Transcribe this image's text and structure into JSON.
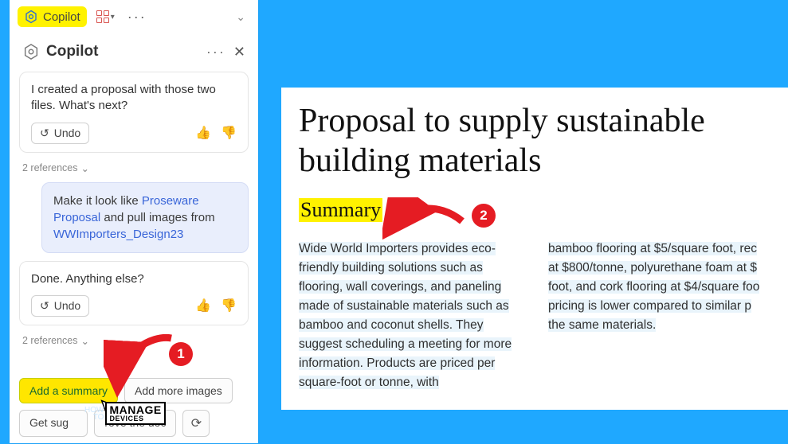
{
  "toolbar": {
    "copilot_label": "Copilot"
  },
  "panel": {
    "title": "Copilot",
    "block1_text": "I created a proposal with those two files. What's next?",
    "undo_label": "Undo",
    "refs_label": "2 references",
    "user_prefix": "Make it look like ",
    "user_link1": "Proseware Proposal",
    "user_mid": " and pull images from ",
    "user_link2": "WWImporters_Design23",
    "block2_text": "Done. Anything else?",
    "sugg_add_summary": "Add a summary",
    "sugg_add_images": "Add more images",
    "sugg_get": "Get sug",
    "sugg_improve": "rove the doc"
  },
  "doc": {
    "title": "Proposal to supply sustainable building materials",
    "summary_heading": "Summary",
    "col1": "Wide World Importers provides eco-friendly building solutions such as flooring, wall coverings, and paneling made of sustainable materials such as bamboo and coconut shells. They suggest scheduling a meeting for more information. Products are priced per square-foot or tonne, with",
    "col2": "bamboo flooring at $5/square foot, rec at $800/tonne, polyurethane foam at $ foot, and cork flooring at $4/square foo pricing is lower compared to similar p the same materials."
  },
  "annot": {
    "b1": "1",
    "b2": "2"
  },
  "watermark": {
    "howto1": "HOW",
    "howto2": "TO",
    "manage": "MANAGE",
    "devices": "DEVICES"
  }
}
